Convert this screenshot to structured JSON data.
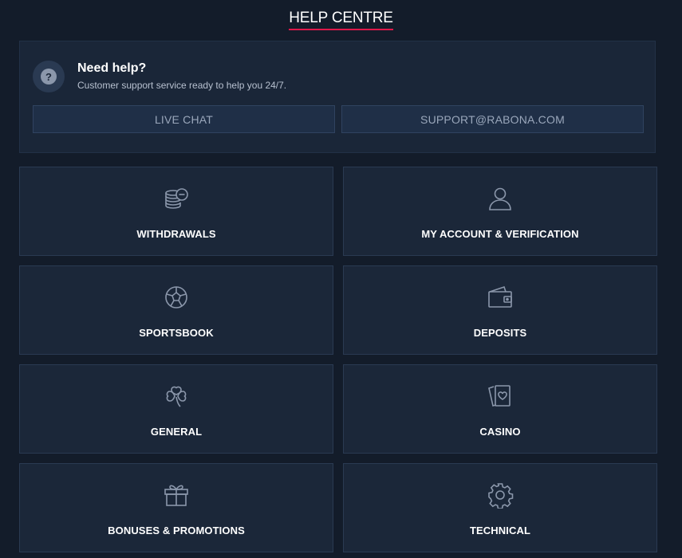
{
  "header": {
    "title": "HELP CENTRE"
  },
  "help": {
    "icon": "question-icon",
    "title": "Need help?",
    "subtitle": "Customer support service ready to help you 24/7.",
    "live_chat_label": "LIVE CHAT",
    "email_label": "SUPPORT@RABONA.COM"
  },
  "categories": [
    {
      "label": "WITHDRAWALS",
      "icon": "coins-icon"
    },
    {
      "label": "MY ACCOUNT & VERIFICATION",
      "icon": "user-icon"
    },
    {
      "label": "SPORTSBOOK",
      "icon": "soccer-ball-icon"
    },
    {
      "label": "DEPOSITS",
      "icon": "wallet-icon"
    },
    {
      "label": "GENERAL",
      "icon": "clover-icon"
    },
    {
      "label": "CASINO",
      "icon": "playing-cards-icon"
    },
    {
      "label": "BONUSES & PROMOTIONS",
      "icon": "gift-icon"
    },
    {
      "label": "TECHNICAL",
      "icon": "gear-icon"
    }
  ],
  "colors": {
    "accent": "#e0184a",
    "background": "#131c2a",
    "card": "#1b2739",
    "icon_stroke": "#8b97ab"
  }
}
